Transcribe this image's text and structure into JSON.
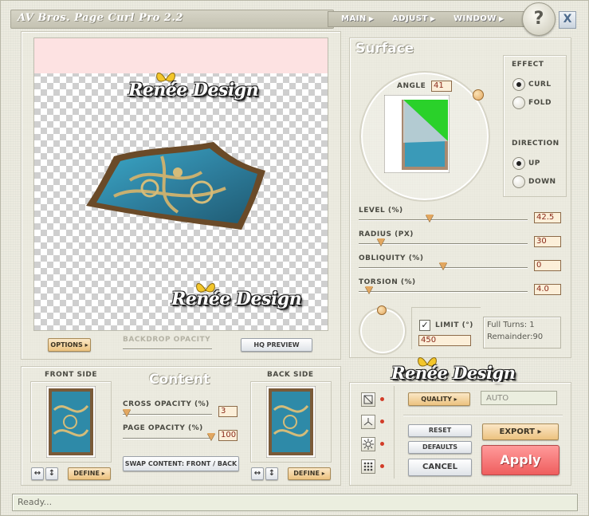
{
  "window": {
    "title": "AV Bros. Page Curl Pro 2.2",
    "help_label": "?",
    "close_label": "X"
  },
  "menu": [
    {
      "label": "MAIN",
      "arrow": "▶"
    },
    {
      "label": "ADJUST",
      "arrow": "▶"
    },
    {
      "label": "WINDOW",
      "arrow": "▶"
    }
  ],
  "watermark": "Renée Design",
  "preview_bar": {
    "options_label": "OPTIONS",
    "backdrop_opacity_label": "BACKDROP OPACITY",
    "hq_preview_label": "HQ PREVIEW"
  },
  "surface": {
    "title": "Surface",
    "angle_label": "ANGLE",
    "angle_value": "41",
    "effect_label": "EFFECT",
    "effect_options": [
      "CURL",
      "FOLD"
    ],
    "effect_selected": "CURL",
    "direction_label": "DIRECTION",
    "direction_options": [
      "UP",
      "DOWN"
    ],
    "direction_selected": "UP",
    "sliders": [
      {
        "label": "LEVEL (%)",
        "value": "42.5",
        "fraction": 0.42
      },
      {
        "label": "RADIUS (PX)",
        "value": "30",
        "fraction": 0.13
      },
      {
        "label": "OBLIQUITY (%)",
        "value": "0",
        "fraction": 0.5
      },
      {
        "label": "TORSION (%)",
        "value": "4.0",
        "fraction": 0.06
      }
    ],
    "limit_label": "LIMIT (°)",
    "limit_checked": true,
    "limit_value": "450",
    "full_turns": "Full Turns:  1",
    "remainder": "Remainder:90"
  },
  "content": {
    "title": "Content",
    "front_side_label": "FRONT SIDE",
    "back_side_label": "BACK SIDE",
    "cross_opacity_label": "CROSS OPACITY (%)",
    "cross_opacity_value": "3",
    "page_opacity_label": "PAGE OPACITY (%)",
    "page_opacity_value": "100",
    "swap_label": "SWAP CONTENT: FRONT / BACK",
    "define_label": "DEFINE",
    "flip_h": "↔",
    "flip_v": "↕"
  },
  "actions": {
    "quality_label": "QUALITY",
    "quality_value": "AUTO",
    "reset_label": "RESET",
    "defaults_label": "DEFAULTS",
    "cancel_label": "CANCEL",
    "export_label": "EXPORT",
    "apply_label": "Apply"
  },
  "status": {
    "text": "Ready..."
  },
  "colors": {
    "accent_orange": "#e2a760",
    "apply_red": "#f06a6a",
    "curl_green": "#2ad12a"
  }
}
